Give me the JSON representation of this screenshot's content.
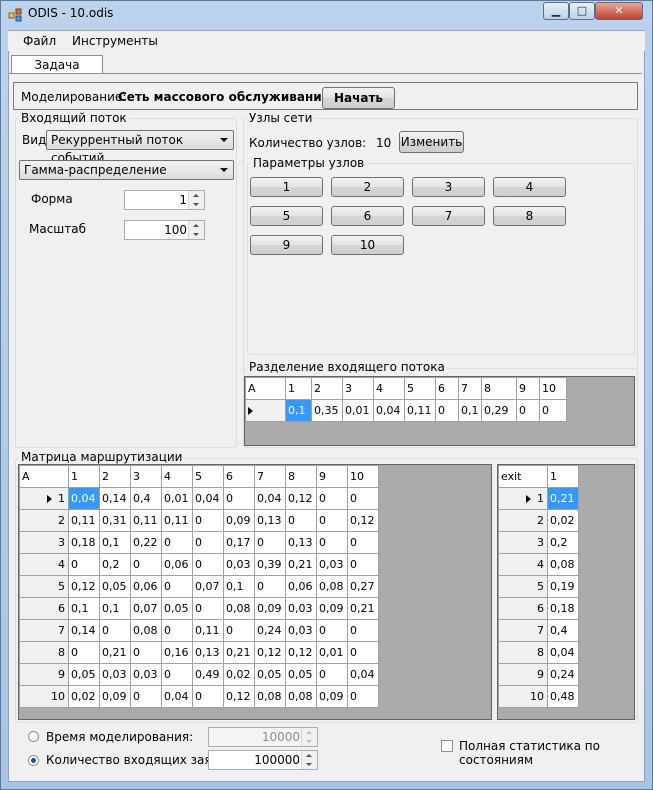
{
  "window": {
    "title": "ODIS - 10.odis",
    "min": "▁",
    "max": "□",
    "close": "✕"
  },
  "menu": {
    "file": "Файл",
    "tools": "Инструменты"
  },
  "tabs": {
    "task": "Задача"
  },
  "modeling": {
    "label": "Моделирование:",
    "value": "Сеть массового обслуживания",
    "start_button": "Начать"
  },
  "incoming": {
    "title": "Входящий поток",
    "kind_label": "Вид",
    "kind_value": "Рекуррентный поток событий",
    "distribution_value": "Гамма-распределение",
    "form_label": "Форма",
    "form_value": "1",
    "scale_label": "Масштаб",
    "scale_value": "100"
  },
  "nodes": {
    "title": "Узлы сети",
    "count_label": "Количество узлов:",
    "count_value": "10",
    "change_button": "Изменить",
    "params_title": "Параметры узлов",
    "buttons": [
      "1",
      "2",
      "3",
      "4",
      "5",
      "6",
      "7",
      "8",
      "9",
      "10"
    ]
  },
  "split": {
    "title": "Разделение входящего потока",
    "corner": "A",
    "headers": [
      "1",
      "2",
      "3",
      "4",
      "5",
      "6",
      "7",
      "8",
      "9",
      "10"
    ],
    "values": [
      "0,1",
      "0,35",
      "0,01",
      "0,04",
      "0,11",
      "0",
      "0,1",
      "0,29",
      "0",
      "0"
    ]
  },
  "routing": {
    "title": "Матрица маршрутизации",
    "corner": "A",
    "headers": [
      "1",
      "2",
      "3",
      "4",
      "5",
      "6",
      "7",
      "8",
      "9",
      "10"
    ],
    "rows": [
      {
        "label": "1",
        "cells": [
          "0,04",
          "0,14",
          "0,4",
          "0,01",
          "0,04",
          "0",
          "0,04",
          "0,12",
          "0",
          "0"
        ]
      },
      {
        "label": "2",
        "cells": [
          "0,11",
          "0,31",
          "0,11",
          "0,11",
          "0",
          "0,09",
          "0,13",
          "0",
          "0",
          "0,12"
        ]
      },
      {
        "label": "3",
        "cells": [
          "0,18",
          "0,1",
          "0,22",
          "0",
          "0",
          "0,17",
          "0",
          "0,13",
          "0",
          "0"
        ]
      },
      {
        "label": "4",
        "cells": [
          "0",
          "0,2",
          "0",
          "0,06",
          "0",
          "0,03",
          "0,39",
          "0,21",
          "0,03",
          "0"
        ]
      },
      {
        "label": "5",
        "cells": [
          "0,12",
          "0,05",
          "0,06",
          "0",
          "0,07",
          "0,1",
          "0",
          "0,06",
          "0,08",
          "0,27"
        ]
      },
      {
        "label": "6",
        "cells": [
          "0,1",
          "0,1",
          "0,07",
          "0,05",
          "0",
          "0,08",
          "0,09",
          "0,03",
          "0,09",
          "0,21"
        ]
      },
      {
        "label": "7",
        "cells": [
          "0,14",
          "0",
          "0,08",
          "0",
          "0,11",
          "0",
          "0,24",
          "0,03",
          "0",
          "0"
        ]
      },
      {
        "label": "8",
        "cells": [
          "0",
          "0,21",
          "0",
          "0,16",
          "0,13",
          "0,21",
          "0,12",
          "0,12",
          "0,01",
          "0"
        ]
      },
      {
        "label": "9",
        "cells": [
          "0,05",
          "0,03",
          "0,03",
          "0",
          "0,49",
          "0,02",
          "0,05",
          "0,05",
          "0",
          "0,04"
        ]
      },
      {
        "label": "10",
        "cells": [
          "0,02",
          "0,09",
          "0",
          "0,04",
          "0",
          "0,12",
          "0,08",
          "0,08",
          "0,09",
          "0"
        ]
      }
    ]
  },
  "exit": {
    "corner": "exit",
    "header": "1",
    "rows": [
      {
        "label": "1",
        "value": "0,21"
      },
      {
        "label": "2",
        "value": "0,02"
      },
      {
        "label": "3",
        "value": "0,2"
      },
      {
        "label": "4",
        "value": "0,08"
      },
      {
        "label": "5",
        "value": "0,19"
      },
      {
        "label": "6",
        "value": "0,18"
      },
      {
        "label": "7",
        "value": "0,4"
      },
      {
        "label": "8",
        "value": "0,04"
      },
      {
        "label": "9",
        "value": "0,24"
      },
      {
        "label": "10",
        "value": "0,48"
      }
    ]
  },
  "bottom": {
    "time_label": "Время моделирования:",
    "time_value": "10000",
    "count_label": "Количество входящих заявок:",
    "count_value": "100000",
    "full_stats_label": "Полная статистика по состояниям"
  }
}
